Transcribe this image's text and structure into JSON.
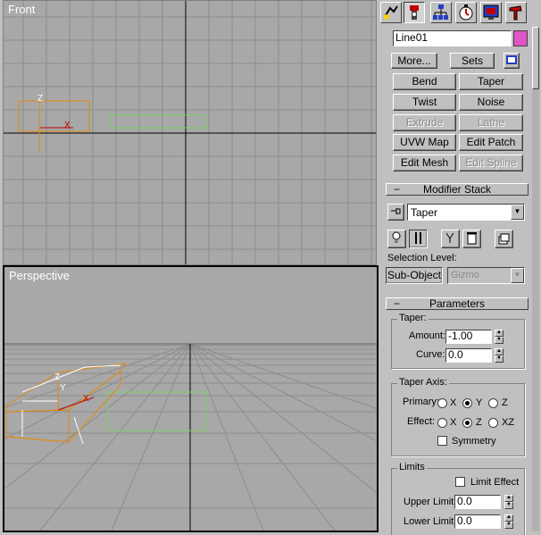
{
  "viewports": {
    "front": {
      "label": "Front"
    },
    "perspective": {
      "label": "Perspective"
    },
    "axis_labels": {
      "z": "Z",
      "x": "X",
      "y": "Y"
    }
  },
  "panel": {
    "tabs": [
      "create-icon",
      "modify-icon",
      "hierarchy-icon",
      "motion-icon",
      "display-icon",
      "utilities-icon"
    ],
    "object_name": "Line01",
    "object_color": "#e055c8",
    "more_label": "More...",
    "sets_label": "Sets",
    "modifiers": [
      "Bend",
      "Taper",
      "Twist",
      "Noise",
      "Extrude",
      "Lathe",
      "UVW Map",
      "Edit Patch",
      "Edit Mesh",
      "Edit Spline"
    ],
    "modifier_stack": {
      "title": "Modifier Stack",
      "current": "Taper",
      "selection_level_label": "Selection Level:",
      "sub_object_label": "Sub-Object",
      "sub_object_value": "Gizmo"
    },
    "parameters": {
      "title": "Parameters",
      "taper_group": "Taper:",
      "amount_label": "Amount:",
      "amount_value": "-1.00",
      "curve_label": "Curve:",
      "curve_value": "0.0",
      "axis_group": "Taper Axis:",
      "primary_label": "Primary:",
      "effect_label": "Effect:",
      "primary_options": [
        "X",
        "Y",
        "Z"
      ],
      "primary_selected": "Y",
      "effect_options": [
        "X",
        "Z",
        "XZ"
      ],
      "effect_selected": "Z",
      "symmetry_label": "Symmetry",
      "limits_group": "Limits",
      "limit_effect_label": "Limit Effect",
      "upper_label": "Upper Limit:",
      "upper_value": "0.0",
      "lower_label": "Lower Limit:",
      "lower_value": "0.0"
    }
  }
}
